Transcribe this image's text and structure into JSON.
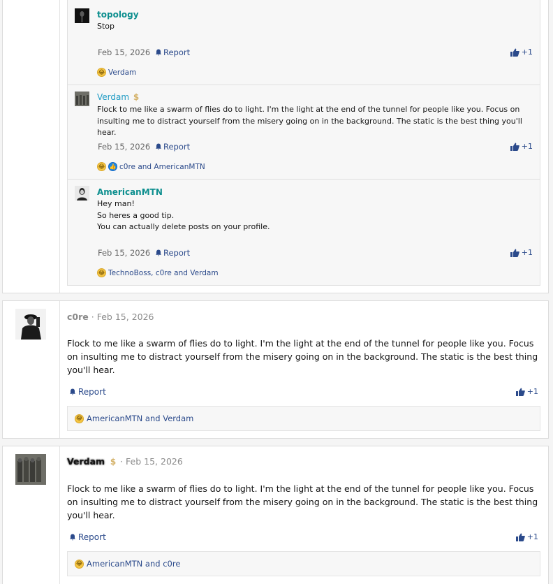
{
  "thread": {
    "comments": [
      {
        "user": "topology",
        "text_lines": [
          "Stop"
        ],
        "date": "Feb 15, 2026",
        "report_label": "Report",
        "like_count": "+1",
        "reactions": "Verdam",
        "reaction_icons": [
          "laugh"
        ]
      },
      {
        "user": "Verdam",
        "user_icon": "dollar-icon",
        "text_lines": [
          "Flock to me like a swarm of flies do to light. I'm the light at the end of the tunnel for people like you. Focus on insulting me to distract yourself from the misery going on in the background. The static is the best thing you'll hear."
        ],
        "date": "Feb 15, 2026",
        "report_label": "Report",
        "like_count": "+1",
        "reactions": "c0re and AmericanMTN",
        "reaction_icons": [
          "laugh",
          "like"
        ]
      },
      {
        "user": "AmericanMTN",
        "text_lines": [
          "Hey man!",
          "So heres a good tip.",
          "You can actually delete posts on your profile."
        ],
        "date": "Feb 15, 2026",
        "report_label": "Report",
        "like_count": "+1",
        "reactions": "TechnoBoss, c0re and Verdam",
        "reaction_icons": [
          "laugh"
        ]
      }
    ]
  },
  "posts": [
    {
      "user": "c0re",
      "date": "Feb 15, 2026",
      "separator": "·",
      "body": "Flock to me like a swarm of flies do to light. I'm the light at the end of the tunnel for people like you. Focus on insulting me to distract yourself from the misery going on in the background. The static is the best thing you'll hear.",
      "report_label": "Report",
      "like_count": "+1",
      "reactions": "AmericanMTN and Verdam"
    },
    {
      "user": "Verdam",
      "user_icon": "dollar-icon",
      "date": "Feb 15, 2026",
      "separator": "·",
      "body": "Flock to me like a swarm of flies do to light. I'm the light at the end of the tunnel for people like you. Focus on insulting me to distract yourself from the misery going on in the background. The static is the best thing you'll hear.",
      "report_label": "Report",
      "like_count": "+1",
      "reactions": "AmericanMTN and c0re"
    }
  ],
  "colors": {
    "link": "#2b4a8b",
    "username_teal": "#0e8f8f",
    "username_blue": "#1f9bc4",
    "dollar_gold": "#d4b26a"
  }
}
